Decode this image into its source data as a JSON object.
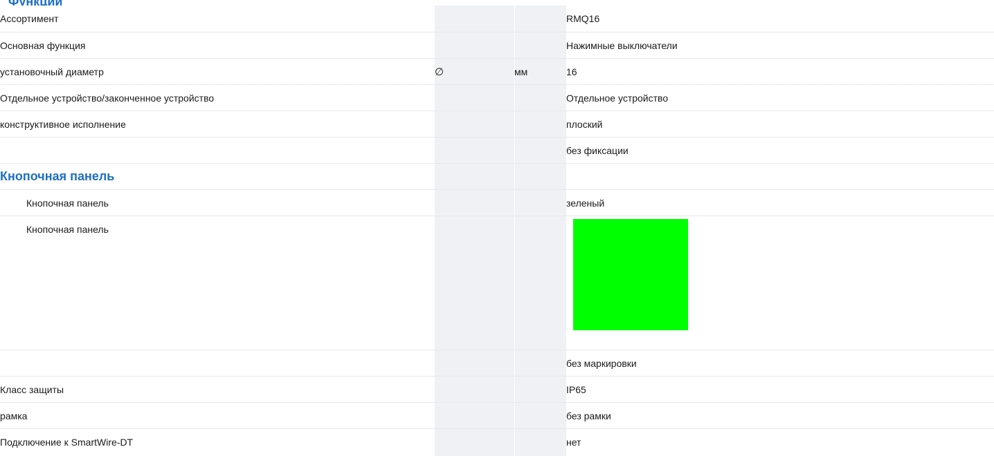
{
  "header_fragment": "Функции",
  "rows": [
    {
      "label": "Ассортимент",
      "symbol": "",
      "unit": "",
      "value": "RMQ16"
    },
    {
      "label": "Основная функция",
      "symbol": "",
      "unit": "",
      "value": "Нажимные выключатели"
    },
    {
      "label": "установочный диаметр",
      "symbol": "∅",
      "unit": "мм",
      "value": "16"
    },
    {
      "label": "Отдельное устройство/законченное устройство",
      "symbol": "",
      "unit": "",
      "value": "Отдельное устройство"
    },
    {
      "label": "конструктивное исполнение",
      "symbol": "",
      "unit": "",
      "value": "плоский"
    },
    {
      "label": "",
      "symbol": "",
      "unit": "",
      "value": "без фиксации"
    }
  ],
  "section": {
    "title": "Кнопочная панель",
    "rows": [
      {
        "label": "Кнопочная панель",
        "value": "зеленый"
      },
      {
        "label": "Кнопочная панель",
        "swatch_color": "#00ff00"
      }
    ]
  },
  "rows_after": [
    {
      "label": "",
      "value": "без маркировки"
    },
    {
      "label": "Класс защиты",
      "value": "IP65"
    },
    {
      "label": "рамка",
      "value": "без рамки"
    },
    {
      "label": "Подключение к SmartWire-DT",
      "value": "нет"
    }
  ]
}
